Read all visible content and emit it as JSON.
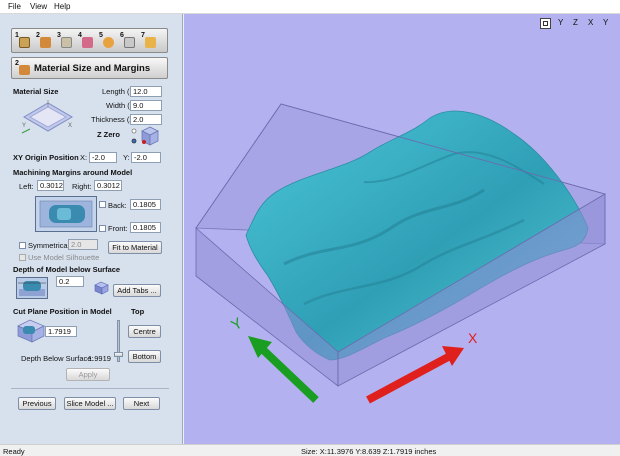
{
  "menu": {
    "file": "File",
    "view": "View",
    "help": "Help"
  },
  "toolbar": {
    "steps": [
      "1",
      "2",
      "3",
      "4",
      "5",
      "6",
      "7"
    ]
  },
  "panel": {
    "step_number": "2",
    "title": "Material Size and Margins"
  },
  "material": {
    "heading": "Material Size",
    "length_label": "Length (X):",
    "length": "12.0",
    "width_label": "Width (Y):",
    "width": "9.0",
    "thickness_label": "Thickness (Z):",
    "thickness": "2.0",
    "zzero_label": "Z Zero"
  },
  "origin": {
    "heading": "XY Origin Position",
    "x_label": "X:",
    "x": "-2.0",
    "y_label": "Y:",
    "y": "-2.0"
  },
  "margins": {
    "heading": "Machining Margins around Model",
    "left_label": "Left:",
    "left": "0.3012",
    "right_label": "Right:",
    "right": "0.3012",
    "back_label": "Back:",
    "back": "0.1805",
    "front_label": "Front:",
    "front": "0.1805",
    "symmetrical_label": "Symmetrical",
    "symmetrical_value": "2.0",
    "silhouette_label": "Use Model Silhouette",
    "fit_button": "Fit to Material"
  },
  "depth": {
    "heading": "Depth of Model below Surface",
    "value": "0.2",
    "add_tabs_button": "Add Tabs ..."
  },
  "cutplane": {
    "heading": "Cut Plane Position in Model",
    "top_label": "Top",
    "value": "1.7919",
    "centre_button": "Centre",
    "bottom_button": "Bottom",
    "depth_label": "Depth Below Surface:",
    "depth_value": "1.9919",
    "apply_button": "Apply"
  },
  "nav": {
    "previous": "Previous",
    "slice": "Slice Model ...",
    "next": "Next"
  },
  "viewtools": {
    "fit": "fit-view-icon",
    "x_label": "X",
    "y_label": "Y",
    "z_label": "Z"
  },
  "viewport": {
    "x_axis_label": "X",
    "y_axis_label": "Y",
    "x_axis_color": "#e0201c",
    "y_axis_color": "#1a9e22",
    "model_color": "#3cb4c8",
    "background_color": "#b3b1ef"
  },
  "status": {
    "left": "Ready",
    "size": "Size: X:11.3976 Y:8.639 Z:1.7919 inches"
  }
}
